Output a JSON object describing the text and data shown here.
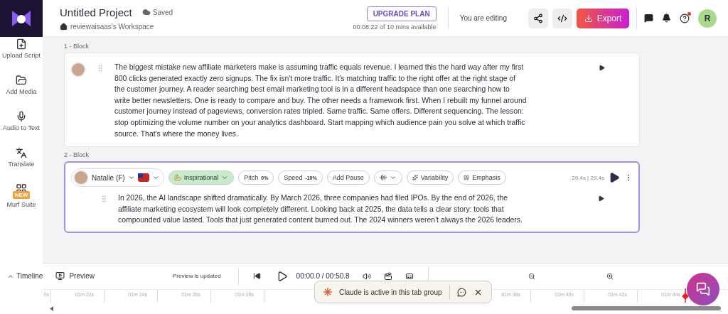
{
  "header": {
    "project_title": "Untitled Project",
    "save_status": "Saved",
    "workspace": "reviewaisaas's Workspace",
    "upgrade_button": "UPGRADE PLAN",
    "time_available": "00:08:22 of 10 mins available",
    "editing_status": "You are editing",
    "export_button": "Export",
    "avatar_initial": "R",
    "help_notification": true
  },
  "sidebar": {
    "items": [
      {
        "label": "Upload Script"
      },
      {
        "label": "Add Media"
      },
      {
        "label": "Audio to Text"
      },
      {
        "label": "Translate"
      },
      {
        "label": "Murf Suite",
        "badge": "NEW"
      }
    ]
  },
  "blocks": [
    {
      "label": "1 -  Block",
      "selected": false,
      "text": "The biggest mistake new affiliate marketers make is assuming traffic equals revenue. I learned this the hard way after my first 800 clicks generated exactly zero signups. The fix isn't more traffic. It's matching traffic to the right offer at the right stage of the customer journey. A reader searching best email marketing tool is in a different headspace than one searching how to write better newsletters. One is ready to compare and buy. The other needs a framework first. When I rebuilt my funnel around customer journey instead of pageviews, conversion rates tripled. Same traffic. Same offers. Different sequencing. The lesson: stop optimizing the volume number on your analytics dashboard. Start mapping which audience pain you solve at which traffic source. That's where the money lives."
    },
    {
      "label": "2 -  Block",
      "selected": true,
      "toolbar": {
        "voice": "Natalie (F)",
        "style": "Inspirational",
        "pitch_label": "Pitch",
        "pitch_value": "0%",
        "speed_label": "Speed",
        "speed_value": "-10%",
        "add_pause": "Add Pause",
        "variability": "Variability",
        "emphasis": "Emphasis",
        "duration": "29.4s | 29.4s"
      },
      "text": "In 2026, the AI landscape shifted dramatically. By March 2026, three companies had filed IPOs. By the end of 2026, the affiliate marketing ecosystem will look completely different. Looking back at 2025, the data tells a clear story: tools that compounded value lasted. Tools that just generated content burned out. The 2024 winners weren't always the 2026 leaders."
    }
  ],
  "footer": {
    "timeline_toggle": "Timeline",
    "preview_button": "Preview",
    "preview_status": "Preview is updated",
    "playback_time": "00:00.0 / 00:50.8",
    "ruler_ticks": [
      "0s",
      "01m 22s",
      "01m 24s",
      "01m 26s",
      "01m 28s",
      "01m 38s",
      "01m 40s",
      "01m 42s",
      "01m 44s"
    ]
  },
  "toast": {
    "text": "Claude is active in this tab group"
  }
}
